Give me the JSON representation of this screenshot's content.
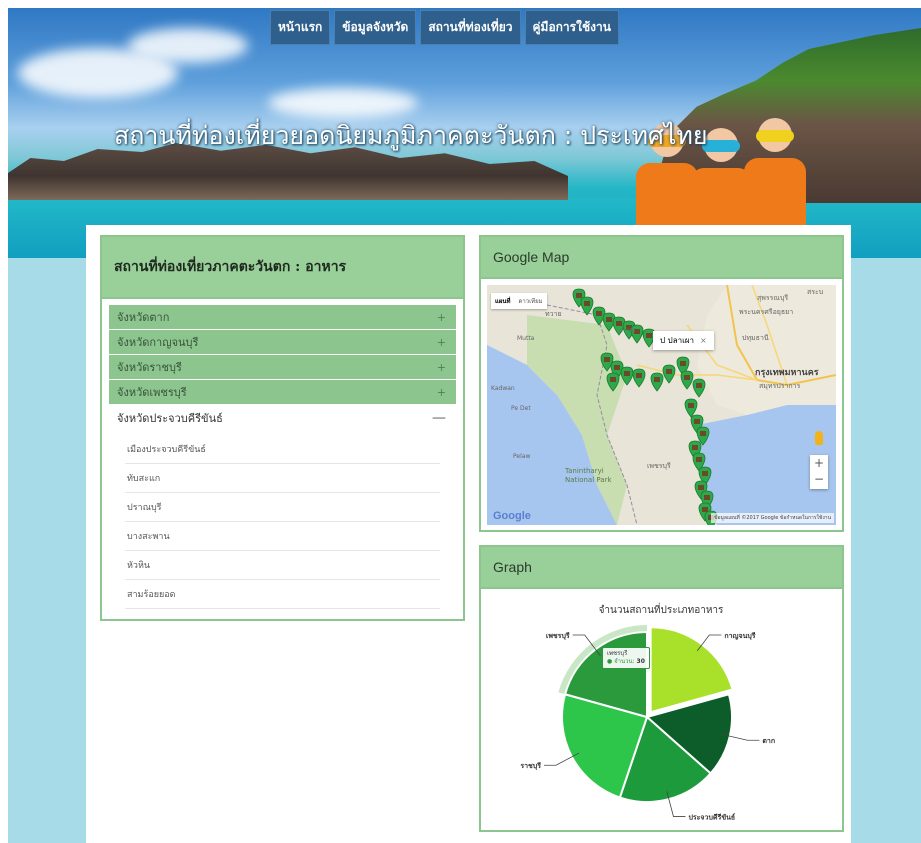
{
  "nav": {
    "items": [
      {
        "label": "หน้าแรก"
      },
      {
        "label": "ข้อมูลจังหวัด"
      },
      {
        "label": "สถานที่ท่องเที่ยว"
      },
      {
        "label": "คู่มือการใช้งาน"
      }
    ]
  },
  "hero": {
    "title": "สถานที่ท่องเที่ยวยอดนิยมภูมิภาคตะวันตก : ประเทศไทย"
  },
  "left_panel": {
    "title": "สถานที่ท่องเที่ยวภาคตะวันตก : อาหาร",
    "provinces": [
      {
        "label": "จังหวัดตาก",
        "toggle": "+"
      },
      {
        "label": "จังหวัดกาญจนบุรี",
        "toggle": "+"
      },
      {
        "label": "จังหวัดราชบุรี",
        "toggle": "+"
      },
      {
        "label": "จังหวัดเพชรบุรี",
        "toggle": "+"
      }
    ],
    "open_province": {
      "label": "จังหวัดประจวบคีรีขันธ์",
      "toggle": "—"
    },
    "districts": [
      "เมืองประจวบคีรีขันธ์",
      "ทับสะแก",
      "ปราณบุรี",
      "บางสะพาน",
      "หัวหิน",
      "สามร้อยยอด"
    ]
  },
  "map_panel": {
    "title": "Google Map",
    "map_type_buttons": [
      "แผนที่",
      "ดาวเทียม"
    ],
    "popup_label": "ป ปลาเผา",
    "popup_close": "×",
    "labels": {
      "bangkok": "กรุงเทพมหานคร",
      "suphanburi": "สุพรรณบุรี",
      "ayutthaya": "พระนครศรีอยุธยา",
      "tanintharyi": "Tanintharyi National Park",
      "mutta": "Mutta",
      "kadwan": "Kadwan",
      "pe_det": "Pe Det",
      "pelaw": "Pelaw",
      "phetchaburi": "เพชรบุรี",
      "samut_prakan": "สมุทรปราการ",
      "kanchanaburi": "กาญ",
      "pathum": "ปทุมธานี",
      "saraburi": "สระบ",
      "thai_border": "ทวาย",
      "nakhon": "นครปฐม"
    },
    "zoom_in": "+",
    "zoom_out": "−",
    "google_logo": "Google",
    "attribution": "ข้อมูลแผนที่ ©2017 Google   ข้อกำหนดในการใช้งาน"
  },
  "graph_panel": {
    "title": "Graph",
    "tooltip": {
      "name": "เพชรบุรี",
      "label": "● จำนวน:",
      "value": "30"
    }
  },
  "chart_data": {
    "type": "pie",
    "title": "จำนวนสถานที่ประเภทอาหาร",
    "labels": [
      "กาญจนบุรี",
      "ตาก",
      "ประจวบคีรีขันธ์",
      "ราชบุรี",
      "เพชรบุรี"
    ],
    "values": [
      30,
      23,
      27,
      35,
      30
    ],
    "colors": [
      "#a8e02a",
      "#0d5d2a",
      "#1d9a3c",
      "#2ec64a",
      "#2a9a3c"
    ],
    "highlighted": "เพชรบุรี"
  }
}
